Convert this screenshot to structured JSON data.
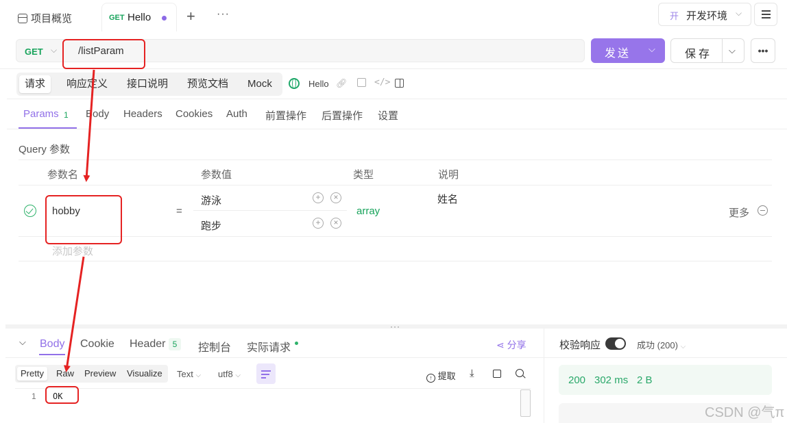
{
  "tabs": {
    "overview": "项目概览",
    "active_method": "GET",
    "active_name": "Hello",
    "add": "+",
    "more": "···"
  },
  "env": {
    "badge": "开",
    "name": "开发环境"
  },
  "request": {
    "method": "GET",
    "path": "/listParam",
    "send_label": "发送",
    "save_label": "保存"
  },
  "subtabs": [
    "请求",
    "响应定义",
    "接口说明",
    "预览文档",
    "Mock"
  ],
  "api_name": "Hello",
  "param_tabs": {
    "params": "Params",
    "params_count": "1",
    "items": [
      "Body",
      "Headers",
      "Cookies",
      "Auth",
      "前置操作",
      "后置操作",
      "设置"
    ]
  },
  "query": {
    "title": "Query 参数",
    "headers": [
      "参数名",
      "参数值",
      "类型",
      "说明"
    ],
    "row": {
      "name": "hobby",
      "eq": "=",
      "values": [
        "游泳",
        "跑步"
      ],
      "type": "array",
      "desc": "姓名",
      "more": "更多"
    },
    "add_placeholder": "添加参数"
  },
  "response": {
    "tabs": {
      "body": "Body",
      "cookie": "Cookie",
      "header": "Header",
      "header_count": "5",
      "console": "控制台",
      "actual": "实际请求"
    },
    "share": "分享",
    "formats": [
      "Pretty",
      "Raw",
      "Preview",
      "Visualize"
    ],
    "text_select": "Text",
    "encoding_select": "utf8",
    "extract": "提取",
    "line_no": "1",
    "body": "OK",
    "validate_label": "校验响应",
    "status_select": "成功 (200)",
    "status_code": "200",
    "time": "302 ms",
    "size": "2 B"
  },
  "watermark": "CSDN @气π",
  "colors": {
    "accent": "#9170e8",
    "get": "#17a35b",
    "annotation": "#e52222"
  }
}
